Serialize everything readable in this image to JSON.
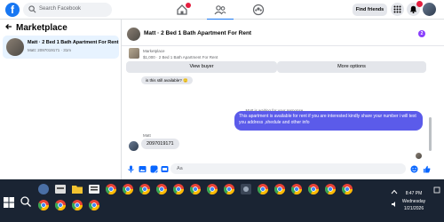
{
  "header": {
    "logo_letter": "f",
    "search_placeholder": "Search Facebook",
    "find_friends": "Find friends"
  },
  "sidebar": {
    "title": "Marketplace",
    "conversation": {
      "title": "Matt · 2 Bed 1 Bath Apartment For Rent",
      "subtitle": "Matt: 2097019171 · 31m"
    }
  },
  "chat": {
    "title": "Matt · 2 Bed 1 Bath Apartment For Rent",
    "listing_label": "Marketplace",
    "listing_price": "$1,000 · 2 Bed 1 Bath Apartment For Rent",
    "view_buyer": "View buyer",
    "more_options": "More options",
    "partial_message": "is this still available? 🙂",
    "waiting_text": "Matt is waiting for your response.",
    "timestamp": "7:14 PM",
    "outgoing_message": "This apartment is available  for rent if you are interested kindly share your number i will text you address ,shedule and other info",
    "sender_name": "Matt",
    "incoming_message": "2097019171",
    "composer_placeholder": "Aa"
  },
  "taskbar": {
    "time": "8:47 PM",
    "day": "Wednesday",
    "date": "1/21/2026"
  },
  "colors": {
    "brand_blue": "#1877f2",
    "outgoing_bubble": "#5b5bea",
    "taskbar": "#1a2433"
  }
}
